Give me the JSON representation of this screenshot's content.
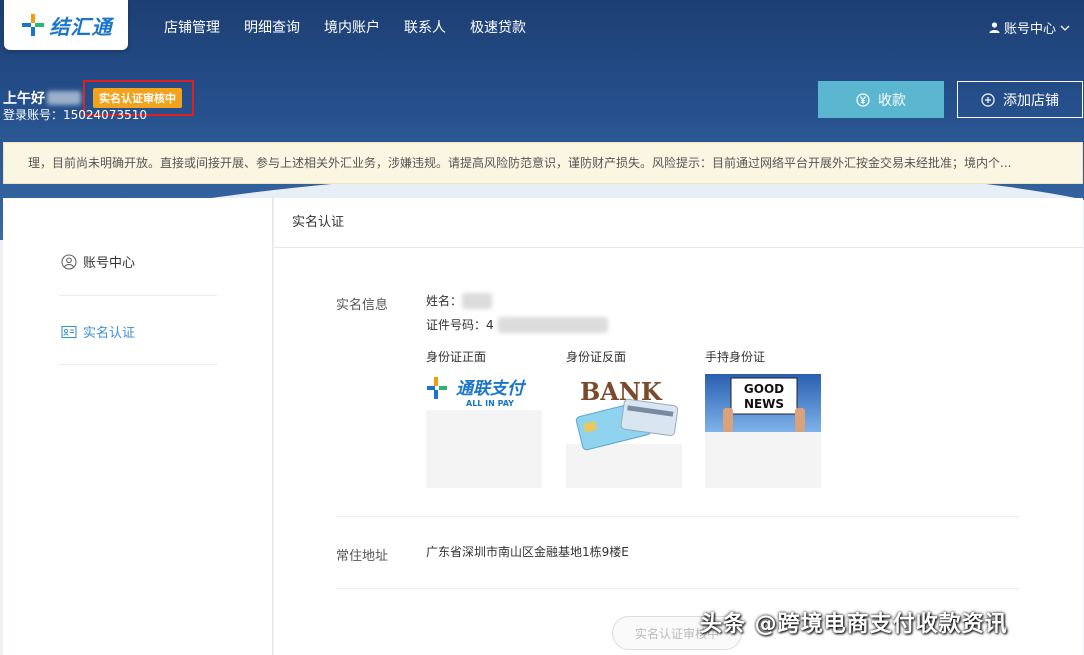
{
  "brand": {
    "name": "结汇通"
  },
  "nav": {
    "items": [
      "店铺管理",
      "明细查询",
      "境内账户",
      "联系人",
      "极速贷款"
    ]
  },
  "header": {
    "account_menu": "账号中心",
    "greeting": "上午好",
    "status_badge": "实名认证审核中",
    "login_account": "登录账号：15024073510",
    "collect_button": "收款",
    "add_shop_button": "添加店铺"
  },
  "notice": {
    "text": "理，目前尚未明确开放。直接或间接开展、参与上述相关外汇业务，涉嫌违规。请提高风险防范意识，谨防财产损失。风险提示：目前通过网络平台开展外汇按金交易未经批准；境内个..."
  },
  "sidebar": {
    "items": [
      {
        "label": "账号中心"
      },
      {
        "label": "实名认证"
      }
    ]
  },
  "main": {
    "title": "实名认证",
    "realname_label": "实名信息",
    "name_label": "姓名：",
    "id_label": "证件号码：4",
    "images": [
      {
        "caption": "身份证正面"
      },
      {
        "caption": "身份证反面"
      },
      {
        "caption": "手持身份证"
      }
    ],
    "image_texts": {
      "front_brand": "通联支付",
      "front_sub": "ALL IN PAY",
      "back_word": "BANK",
      "hand_line1": "GOOD",
      "hand_line2": "NEWS"
    },
    "address_label": "常住地址",
    "address_value": "广东省深圳市南山区金融基地1栋9楼E",
    "submit_button": "实名认证审核中"
  },
  "watermark": {
    "text": "头条 @跨境电商支付收款资讯"
  },
  "colors": {
    "accent": "#5ab7cf",
    "badge": "#f3a21e",
    "highlight": "#e02020",
    "link": "#3f8fd6"
  }
}
